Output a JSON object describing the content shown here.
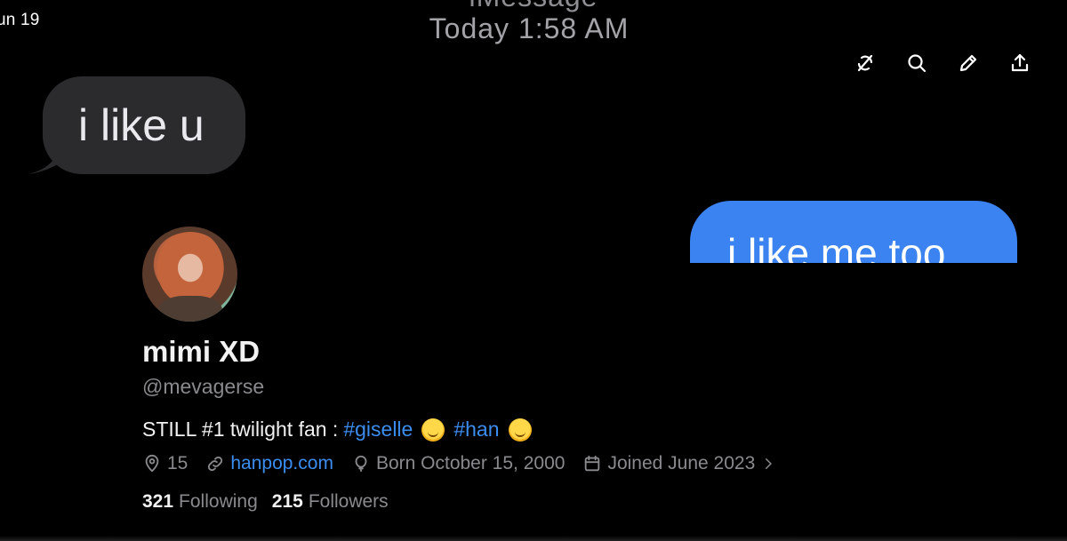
{
  "status_bar": {
    "date": "un 19"
  },
  "imessage": {
    "service": "iMessage",
    "time": "Today 1:58 AM",
    "received_text": "i like u",
    "sent_text": "i like me too",
    "colors": {
      "received_bubble": "#2b2b2e",
      "sent_bubble": "#3a83f0"
    }
  },
  "toolbar": {
    "icons": [
      "unlink-icon",
      "search-icon",
      "pencil-icon",
      "share-icon"
    ]
  },
  "profile": {
    "display_name": "mimi XD",
    "handle": "@mevagerse",
    "bio": {
      "prefix": "STILL #1 twilight fan :",
      "hashtag1": "#giselle",
      "hashtag2": "#han"
    },
    "location": "15",
    "website": "hanpop.com",
    "born": "Born October 15, 2000",
    "joined": "Joined June 2023",
    "following_count": "321",
    "following_label": "Following",
    "followers_count": "215",
    "followers_label": "Followers",
    "accent_color": "#3b8df0"
  }
}
